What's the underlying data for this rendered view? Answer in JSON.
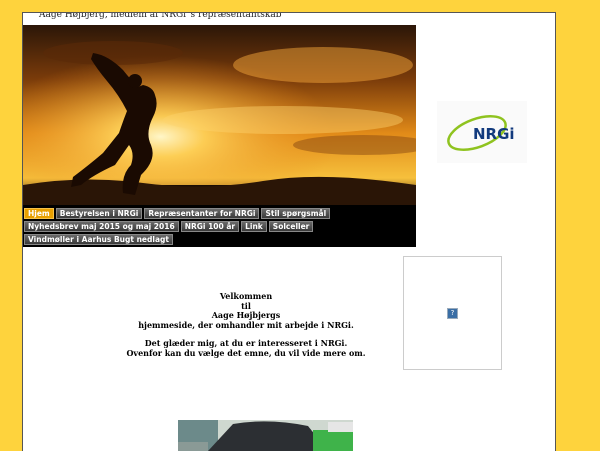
{
  "site": {
    "title": "Aage Højbjerg, medlem af NRGi´s  repræsentantskab"
  },
  "nav": {
    "rows": [
      [
        {
          "label": "Hjem",
          "active": true
        },
        {
          "label": "Bestyrelsen i NRGi",
          "active": false
        },
        {
          "label": "Repræsentanter for NRGi",
          "active": false
        },
        {
          "label": "Stil spørgsmål",
          "active": false
        }
      ],
      [
        {
          "label": "Nyhedsbrev maj 2015 og maj 2016",
          "active": false
        },
        {
          "label": "NRGi 100 år",
          "active": false
        },
        {
          "label": "Link",
          "active": false
        },
        {
          "label": "Solceller",
          "active": false
        }
      ],
      [
        {
          "label": "Vindmøller i Aarhus Bugt nedlagt",
          "active": false
        }
      ]
    ]
  },
  "logo": {
    "text": "NRGi",
    "icon": "nrgi-logo"
  },
  "embed": {
    "placeholder_glyph": "?"
  },
  "welcome": {
    "line1": "Velkommen",
    "line2": "til",
    "line3": "Aage Højbjergs",
    "line4": "hjemmeside, der omhandler mit arbejde i NRGi.",
    "line5": "Det glæder mig, at du er interesseret i NRGi.",
    "line6": "Ovenfor kan du vælge det emne, du vil vide mere om."
  },
  "colors": {
    "background": "#fed33d",
    "nav_active": "#e8a000",
    "logo_blue": "#123a7d",
    "logo_green": "#8fc31f"
  }
}
